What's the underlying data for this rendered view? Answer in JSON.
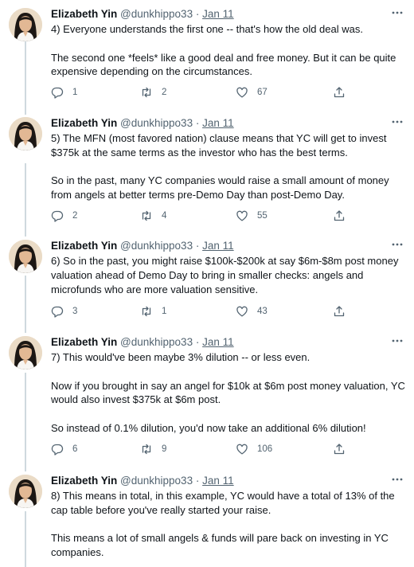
{
  "tweets": [
    {
      "name": "Elizabeth Yin",
      "handle": "@dunkhippo33",
      "sep": "·",
      "date": "Jan 11",
      "paragraphs": [
        "4) Everyone understands the first one -- that's how the old deal was.",
        "The second one *feels* like a good deal and free money. But it can be quite expensive depending on the circumstances."
      ],
      "replies": "1",
      "retweets": "2",
      "likes": "67"
    },
    {
      "name": "Elizabeth Yin",
      "handle": "@dunkhippo33",
      "sep": "·",
      "date": "Jan 11",
      "paragraphs": [
        "5) The MFN (most favored nation) clause means that YC will get to invest $375k at the same terms as the investor who has the best terms.",
        "So in the past, many YC companies would raise a small amount of money from angels at better terms pre-Demo Day than post-Demo Day."
      ],
      "replies": "2",
      "retweets": "4",
      "likes": "55"
    },
    {
      "name": "Elizabeth Yin",
      "handle": "@dunkhippo33",
      "sep": "·",
      "date": "Jan 11",
      "paragraphs": [
        "6) So in the past, you might raise $100k-$200k at say $6m-$8m post money valuation ahead of Demo Day to bring in smaller checks: angels and microfunds who are more valuation sensitive."
      ],
      "replies": "3",
      "retweets": "1",
      "likes": "43"
    },
    {
      "name": "Elizabeth Yin",
      "handle": "@dunkhippo33",
      "sep": "·",
      "date": "Jan 11",
      "paragraphs": [
        "7) This would've been maybe 3% dilution -- or less even.",
        "Now if you brought in say an angel for $10k at $6m post money valuation, YC would also invest $375k at $6m post.",
        "So instead of 0.1% dilution, you'd now take an additional 6% dilution!"
      ],
      "replies": "6",
      "retweets": "9",
      "likes": "106"
    },
    {
      "name": "Elizabeth Yin",
      "handle": "@dunkhippo33",
      "sep": "·",
      "date": "Jan 11",
      "paragraphs": [
        "8) This means in total, in this example, YC would have a total of 13% of the cap table before you've really started your raise.",
        "This means a lot of small angels & funds will pare back on investing in YC companies."
      ]
    }
  ]
}
